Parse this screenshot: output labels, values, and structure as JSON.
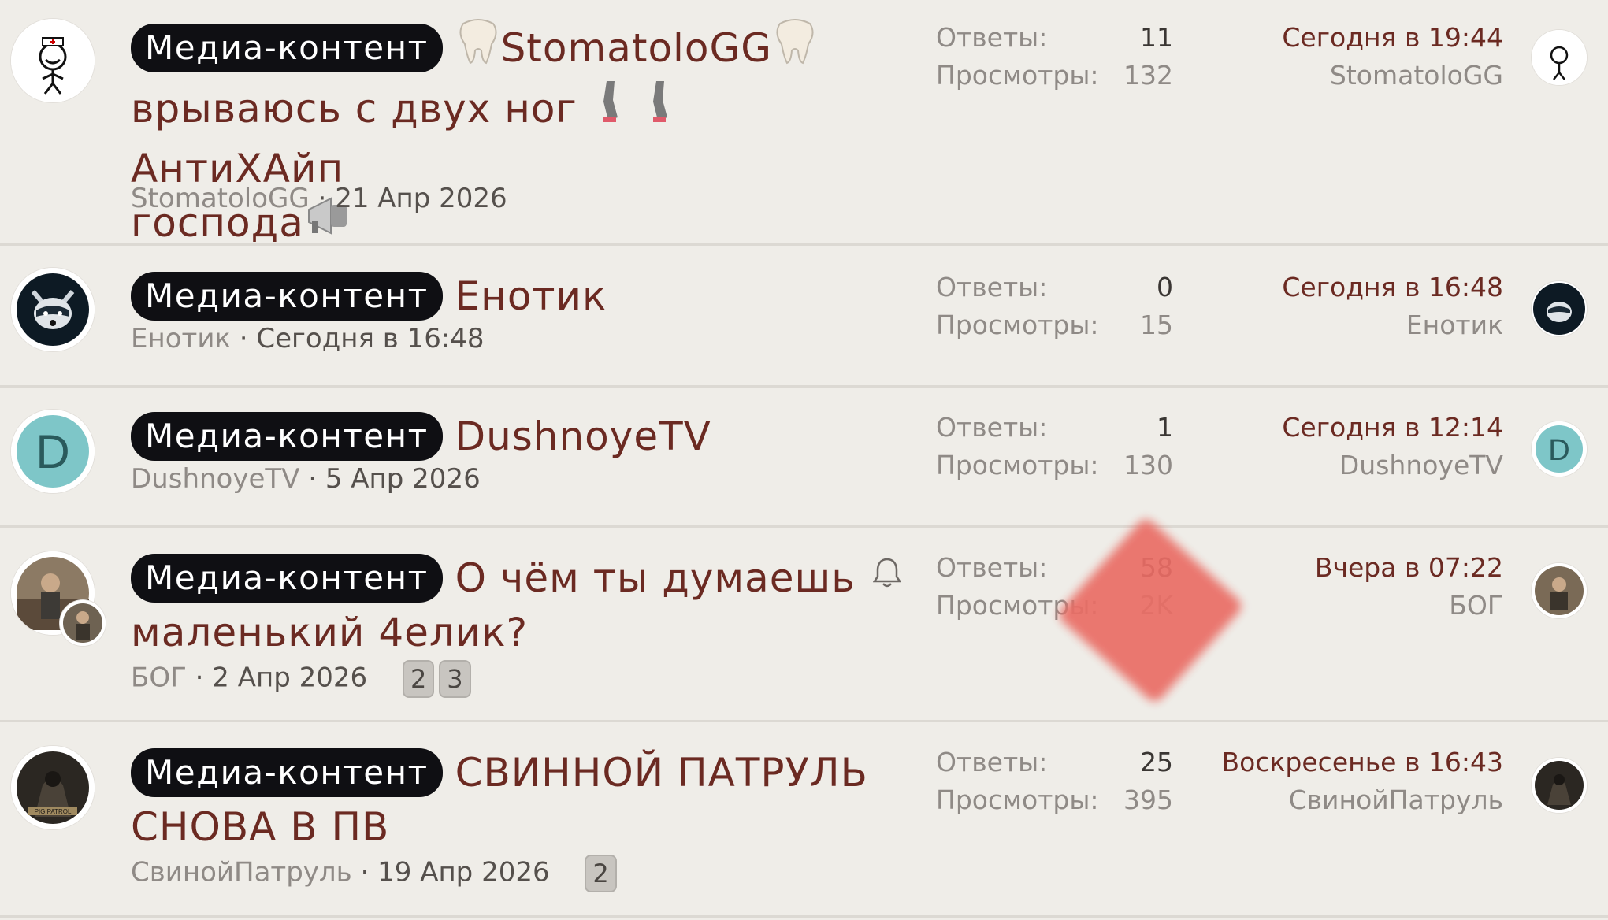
{
  "labels": {
    "replies": "Ответы:",
    "views": "Просмотры:"
  },
  "colors": {
    "title": "#6b2a22",
    "prefix_bg": "#0f0f13",
    "avatar_d": "#7ec6c8"
  },
  "threads": [
    {
      "prefix": "Медиа-контент",
      "title_parts": [
        "StomatoloGG",
        "врываюсь с двух ног",
        "АнтиХАйп",
        "господа"
      ],
      "icons": [
        "tooth-icon",
        "leg-icon",
        "megaphone-icon"
      ],
      "author": "StomatoloGG",
      "date": "21 Апр 2026",
      "replies": "11",
      "views": "132",
      "last_date": "Сегодня в 19:44",
      "last_user": "StomatoloGG"
    },
    {
      "prefix": "Медиа-контент",
      "title": "Енотик",
      "author": "Енотик",
      "date": "Сегодня в 16:48",
      "replies": "0",
      "views": "15",
      "last_date": "Сегодня в 16:48",
      "last_user": "Енотик"
    },
    {
      "prefix": "Медиа-контент",
      "title": "DushnoyeTV",
      "avatar_letter": "D",
      "author": "DushnoyeTV",
      "date": "5 Апр 2026",
      "replies": "1",
      "views": "130",
      "last_date": "Сегодня в 12:14",
      "last_user": "DushnoyeTV"
    },
    {
      "prefix": "Медиа-контент",
      "title_line1": "О чём ты думаешь",
      "title_line2": "маленький 4елик?",
      "author": "БОГ",
      "date": "2 Апр 2026",
      "pages": [
        "2",
        "3"
      ],
      "replies": "58",
      "views": "2K",
      "last_date": "Вчера в 07:22",
      "last_user": "БОГ"
    },
    {
      "prefix": "Медиа-контент",
      "title_line1": "СВИННОЙ ПАТРУЛЬ",
      "title_line2": "СНОВА В ПВ",
      "author": "СвинойПатруль",
      "author_display": "СвинойПатруль",
      "date": "19 Апр 2026",
      "pages": [
        "2"
      ],
      "replies": "25",
      "views": "395",
      "last_date": "Воскресенье в 16:43",
      "last_user": "СвинойПатруль",
      "avatar_text": "PIG PATROL"
    }
  ]
}
